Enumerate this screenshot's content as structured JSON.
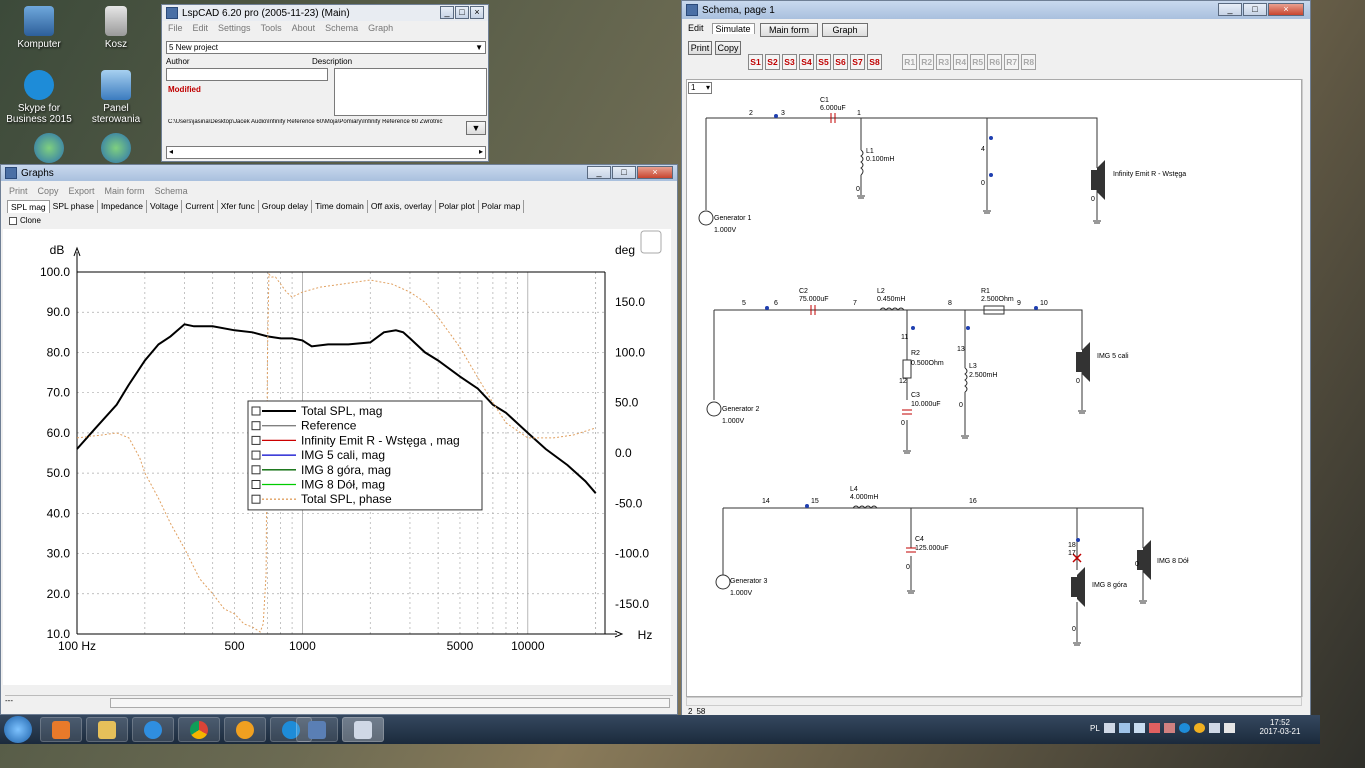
{
  "desktop": {
    "icons": [
      {
        "label": "Komputer"
      },
      {
        "label": "Kosz"
      },
      {
        "label": "Skype for Business 2015"
      },
      {
        "label": "Panel sterowania"
      }
    ]
  },
  "main_window": {
    "title": "LspCAD 6.20 pro (2005-11-23) (Main)",
    "menu": [
      "File",
      "Edit",
      "Settings",
      "Tools",
      "About",
      "Schema",
      "Graph"
    ],
    "project": "5 New project",
    "author_label": "Author",
    "description_label": "Description",
    "status": "Modified",
    "path": "C:\\Users\\jasina\\Desktop\\Jacek Audio\\Infinity Reference 60\\Moja\\Pomiary\\Infinity Reference 60 Zwrotnic"
  },
  "graphs_window": {
    "title": "Graphs",
    "menu": [
      "Print",
      "Copy",
      "Export",
      "Main form",
      "Schema"
    ],
    "tabs": [
      "SPL mag",
      "SPL phase",
      "Impedance",
      "Voltage",
      "Current",
      "Xfer func",
      "Group delay",
      "Time domain",
      "Off axis, overlay",
      "Polar plot",
      "Polar map"
    ],
    "clone_label": "Clone",
    "status_text": "---"
  },
  "chart_data": {
    "type": "line",
    "xlabel": "Hz",
    "ylabel": "dB",
    "y2label": "deg",
    "xscale": "log",
    "xlim": [
      100,
      22000
    ],
    "ylim": [
      10,
      100
    ],
    "y2lim": [
      -180,
      180
    ],
    "x_ticks": [
      "100 Hz",
      "500",
      "1000",
      "5000",
      "10000"
    ],
    "x_tick_values": [
      100,
      500,
      1000,
      5000,
      10000
    ],
    "y_ticks": [
      "10.0",
      "20.0",
      "30.0",
      "40.0",
      "50.0",
      "60.0",
      "70.0",
      "80.0",
      "90.0",
      "100.0"
    ],
    "y2_ticks": [
      "-150.0",
      "-100.0",
      "-50.0",
      "0.0",
      "50.0",
      "100.0",
      "150.0"
    ],
    "legend": [
      "Total SPL, mag",
      "Reference",
      "Infinity Emit R - Wstęga , mag",
      "IMG 5 cali, mag",
      "IMG 8 góra, mag",
      "IMG 8 Dół, mag",
      "Total SPL, phase"
    ],
    "legend_colors": [
      "#000000",
      "#808080",
      "#cc0000",
      "#0000cc",
      "#006600",
      "#00cc00",
      "#e0a060"
    ],
    "series": [
      {
        "name": "Total SPL, mag",
        "color": "#000000",
        "axis": "left",
        "x": [
          100,
          120,
          150,
          170,
          200,
          230,
          260,
          300,
          330,
          400,
          500,
          600,
          700,
          800,
          900,
          1000,
          1100,
          1300,
          1600,
          2000,
          2300,
          2600,
          2800,
          3000,
          3500,
          4000,
          5000,
          6000,
          7000,
          8000,
          10000,
          12000,
          15000,
          18000,
          20000
        ],
        "y": [
          56,
          61,
          67,
          72,
          78,
          82,
          84,
          87,
          86.5,
          86.5,
          85.5,
          85,
          84,
          83.5,
          83.5,
          83,
          81.5,
          82,
          82,
          82.5,
          85,
          85.5,
          85,
          83.5,
          80,
          78,
          74,
          71,
          67,
          65,
          60,
          56,
          52,
          48,
          45
        ]
      },
      {
        "name": "Total SPL, phase",
        "color": "#e0a060",
        "axis": "right",
        "x": [
          100,
          130,
          150,
          170,
          190,
          200,
          230,
          260,
          300,
          350,
          400,
          450,
          500,
          550,
          600,
          650,
          670,
          690,
          700,
          710,
          730,
          760,
          800,
          850,
          900,
          1000,
          1200,
          1500,
          2000,
          2500,
          3000,
          3500,
          4000,
          5000,
          6000,
          7000,
          8000,
          10000,
          13000,
          16000,
          20000
        ],
        "y": [
          15,
          18,
          20,
          15,
          -5,
          -20,
          -45,
          -70,
          -95,
          -125,
          -140,
          -155,
          -160,
          -170,
          -173,
          -178,
          -170,
          -120,
          100,
          178,
          175,
          175,
          168,
          160,
          155,
          160,
          165,
          168,
          172,
          168,
          160,
          150,
          135,
          105,
          75,
          50,
          30,
          15,
          15,
          18,
          25
        ]
      }
    ]
  },
  "schema_window": {
    "title": "Schema, page 1",
    "menu": [
      "Edit",
      "Simulate"
    ],
    "buttons": [
      "Main form",
      "Graph"
    ],
    "print_label": "Print",
    "copy_label": "Copy",
    "sim_buttons": [
      "S1",
      "S2",
      "S3",
      "S4",
      "S5",
      "S6",
      "S7",
      "S8"
    ],
    "ref_buttons": [
      "R1",
      "R2",
      "R3",
      "R4",
      "R5",
      "R6",
      "R7",
      "R8"
    ],
    "page_select": "1",
    "status_left": "2",
    "status_right": "58",
    "labels": {
      "n2": "2",
      "n3": "3",
      "n1": "1",
      "c1": "C1",
      "c1v": "6.000uF",
      "l1": "L1",
      "l1v": "0.100mH",
      "n0a": "0",
      "n4": "4",
      "n0b": "0",
      "n0c": "0",
      "spk1": "Infinity Emit R - Wstęga",
      "gen1": "Generator 1",
      "gen1v": "1.000V",
      "n5": "5",
      "n6": "6",
      "c2": "C2",
      "c2v": "75.000uF",
      "n7": "7",
      "l2": "L2",
      "l2v": "0.450mH",
      "n8": "8",
      "r1": "R1",
      "r1v": "2.500Ohm",
      "n9": "9",
      "n10": "10",
      "n11": "11",
      "n13": "13",
      "r2": "R2",
      "r2v": "0.500Ohm",
      "l3": "L3",
      "l3v": "2.500mH",
      "n12": "12",
      "c3": "C3",
      "c3v": "10.000uF",
      "n0d": "0",
      "n0e": "0",
      "n0f": "0",
      "spk2": "IMG 5 cali",
      "gen2": "Generator 2",
      "gen2v": "1.000V",
      "n14": "14",
      "n15": "15",
      "l4": "L4",
      "l4v": "4.000mH",
      "n16": "16",
      "c4": "C4",
      "c4v": "125.000uF",
      "n0g": "0",
      "n18": "18",
      "n17": "17",
      "spk3": "IMG 8 góra",
      "spk4": "IMG 8 Dół",
      "n0h": "0",
      "n0i": "0",
      "gen3": "Generator 3",
      "gen3v": "1.000V"
    }
  },
  "taskbar": {
    "lang": "PL",
    "time": "17:52",
    "date": "2017-03-21"
  }
}
